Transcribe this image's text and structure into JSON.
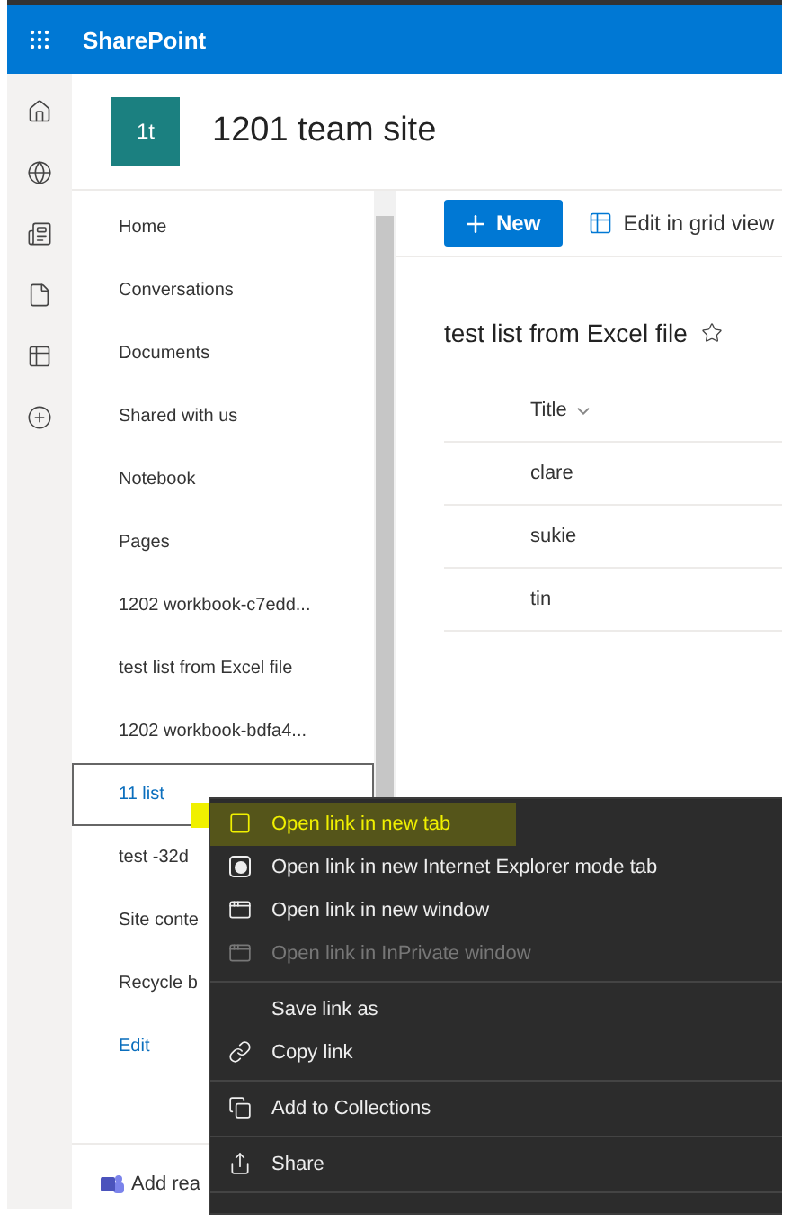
{
  "app": {
    "name": "SharePoint"
  },
  "site": {
    "logo": "1t",
    "title": "1201 team site"
  },
  "nav": [
    {
      "label": "Home",
      "selected": false,
      "kind": "page"
    },
    {
      "label": "Conversations",
      "selected": false,
      "kind": "page"
    },
    {
      "label": "Documents",
      "selected": false,
      "kind": "page"
    },
    {
      "label": "Shared with us",
      "selected": false,
      "kind": "page"
    },
    {
      "label": "Notebook",
      "selected": false,
      "kind": "page"
    },
    {
      "label": "Pages",
      "selected": false,
      "kind": "page"
    },
    {
      "label": "1202 workbook-c7edd...",
      "selected": false,
      "kind": "page"
    },
    {
      "label": "test list from Excel file",
      "selected": false,
      "kind": "page"
    },
    {
      "label": "1202 workbook-bdfa4...",
      "selected": false,
      "kind": "page"
    },
    {
      "label": "11 list",
      "selected": true,
      "kind": "page"
    },
    {
      "label": "test -32d",
      "selected": false,
      "kind": "page"
    },
    {
      "label": "Site conte",
      "selected": false,
      "kind": "page"
    },
    {
      "label": "Recycle b",
      "selected": false,
      "kind": "page"
    },
    {
      "label": "Edit",
      "selected": false,
      "kind": "edit"
    }
  ],
  "nav_footer": {
    "label": "Add rea"
  },
  "commands": [
    {
      "label": "New",
      "kind": "primary"
    },
    {
      "label": "Edit in grid view",
      "kind": "grid"
    }
  ],
  "list": {
    "title": "test list from Excel file",
    "columns": [
      "Title"
    ],
    "rows": [
      "clare",
      "sukie",
      "tin"
    ]
  },
  "context_menu": [
    {
      "kind": "tab",
      "label": "Open link in new tab",
      "disabled": false,
      "selected": true
    },
    {
      "kind": "ie",
      "label": "Open link in new Internet Explorer mode tab",
      "disabled": false,
      "selected": false
    },
    {
      "kind": "window",
      "label": "Open link in new window",
      "disabled": false,
      "selected": false
    },
    {
      "kind": "private",
      "label": "Open link in InPrivate window",
      "disabled": true,
      "selected": false
    },
    {
      "kind": "separator"
    },
    {
      "kind": "plain",
      "label": "Save link as",
      "disabled": false,
      "selected": false
    },
    {
      "kind": "link",
      "label": "Copy link",
      "disabled": false,
      "selected": false
    },
    {
      "kind": "separator"
    },
    {
      "kind": "collections",
      "label": "Add to Collections",
      "disabled": false,
      "selected": false
    },
    {
      "kind": "separator"
    },
    {
      "kind": "share",
      "label": "Share",
      "disabled": false,
      "selected": false
    },
    {
      "kind": "separator"
    }
  ]
}
